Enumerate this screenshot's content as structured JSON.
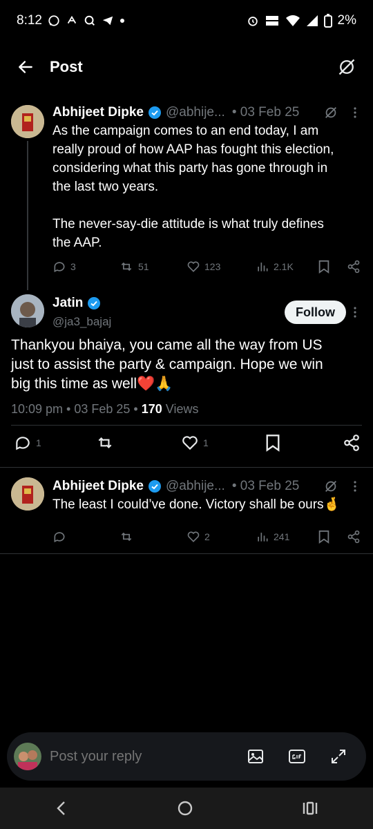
{
  "status": {
    "time": "8:12",
    "battery": "2%"
  },
  "header": {
    "title": "Post"
  },
  "tweet1": {
    "name": "Abhijeet Dipke",
    "handle": "@abhije...",
    "date": "• 03 Feb 25",
    "lines": [
      "As the campaign comes to an end today, I am",
      "really proud of how AAP has fought this election,",
      "considering what this party has gone through in",
      "the last two years.",
      "",
      "The never-say-die attitude is what truly defines",
      "the AAP."
    ],
    "replies": "3",
    "reposts": "51",
    "likes": "123",
    "views": "2.1K"
  },
  "main_tweet": {
    "name": "Jatin",
    "handle": "@ja3_bajaj",
    "follow_label": "Follow",
    "lines": [
      "Thankyou bhaiya, you came all the way from US",
      "just to assist the party & campaign. Hope we win",
      "big this time as well❤️🙏"
    ],
    "time_date": "10:09 pm • 03 Feb 25 •",
    "views_count": "170",
    "views_label": "Views",
    "replies": "1",
    "likes": "1"
  },
  "reply_tweet": {
    "name": "Abhijeet Dipke",
    "handle": "@abhije...",
    "date": "• 03 Feb 25",
    "text": "The least I could’ve done. Victory shall be ours🤞",
    "likes": "2",
    "views": "241"
  },
  "composer": {
    "placeholder": "Post your reply"
  },
  "colors": {
    "accent": "#1d9bf0",
    "background": "#000000",
    "muted": "#71767b"
  }
}
